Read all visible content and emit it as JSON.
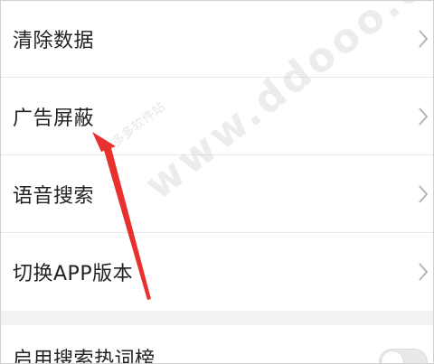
{
  "settings": {
    "items": [
      {
        "label": "清除数据",
        "icon": "chevron-right-icon"
      },
      {
        "label": "广告屏蔽",
        "icon": "chevron-right-icon"
      },
      {
        "label": "语音搜索",
        "icon": "chevron-right-icon"
      },
      {
        "label": "切换APP版本",
        "icon": "chevron-right-icon"
      }
    ],
    "toggle_item": {
      "label": "启用搜索热词榜",
      "enabled": false
    }
  },
  "watermark": {
    "main": "www.ddooo.com",
    "small": "多多软件站"
  },
  "annotation": {
    "icon": "red-arrow-icon",
    "color": "#e8312f"
  }
}
